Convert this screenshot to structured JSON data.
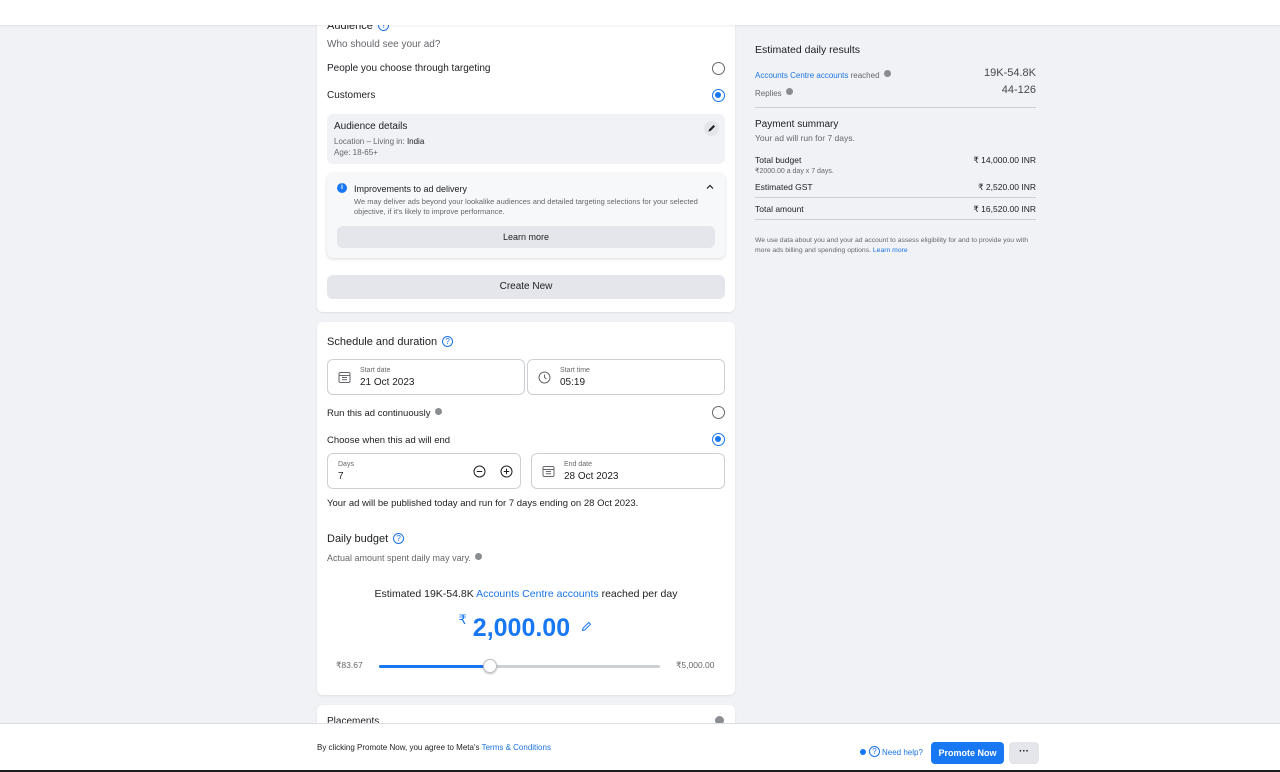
{
  "audience": {
    "heading": "Audience",
    "subtitle": "Who should see your ad?",
    "options": [
      {
        "label": "People you choose through targeting",
        "selected": false
      },
      {
        "label": "Customers",
        "selected": true
      }
    ],
    "details": {
      "title": "Audience details",
      "location_prefix": "Location – Living in: ",
      "location_value": "India",
      "age": "Age: 18-65+"
    },
    "improvements": {
      "title": "Improvements to ad delivery",
      "body": "We may deliver ads beyond your lookalike audiences and detailed targeting selections for your selected objective, if it's likely to improve performance.",
      "learn_more": "Learn more"
    },
    "create_new": "Create New"
  },
  "schedule": {
    "heading": "Schedule and duration",
    "start_date_label": "Start date",
    "start_date": "21 Oct 2023",
    "start_time_label": "Start time",
    "start_time": "05:19",
    "run_continuously": "Run this ad continuously",
    "run_continuously_selected": false,
    "choose_end": "Choose when this ad will end",
    "choose_end_selected": true,
    "days_label": "Days",
    "days": "7",
    "end_date_label": "End date",
    "end_date": "28 Oct 2023",
    "summary": "Your ad will be published today and run for 7 days ending on 28 Oct 2023."
  },
  "budget": {
    "heading": "Daily budget",
    "note": "Actual amount spent daily may vary.",
    "estimate_prefix": "Estimated 19K-54.8K ",
    "estimate_link": "Accounts Centre accounts",
    "estimate_suffix": " reached per day",
    "currency": "₹",
    "amount": "2,000.00",
    "min_label": "₹83.67",
    "max_label": "₹5,000.00",
    "slider_fraction": 0.395
  },
  "placements": {
    "heading": "Placements"
  },
  "results": {
    "heading": "Estimated daily results",
    "reach_link": "Accounts Centre accounts",
    "reach_suffix": " reached",
    "reach_value": "19K-54.8K",
    "replies_label": "Replies",
    "replies_value": "44-126"
  },
  "payment": {
    "heading": "Payment summary",
    "duration": "Your ad will run for 7 days.",
    "total_budget_label": "Total budget",
    "total_budget_value": "₹ 14,000.00 INR",
    "total_budget_detail": "₹2000.00 a day x 7 days.",
    "gst_label": "Estimated GST",
    "gst_value": "₹ 2,520.00 INR",
    "total_label": "Total amount",
    "total_value": "₹ 16,520.00 INR",
    "disclaimer": "We use data about you and your ad account to assess eligibility for and to provide you with more ads billing and spending options. ",
    "disclaimer_link": "Learn more"
  },
  "footer": {
    "terms_prefix": "By clicking Promote Now, you agree to Meta's ",
    "terms_link": "Terms & Conditions",
    "need_help": "Need help?",
    "promote": "Promote Now",
    "more": "···"
  },
  "colors": {
    "accent": "#1877f2",
    "link": "#1b74e4",
    "page_bg": "#f0f2f5"
  }
}
